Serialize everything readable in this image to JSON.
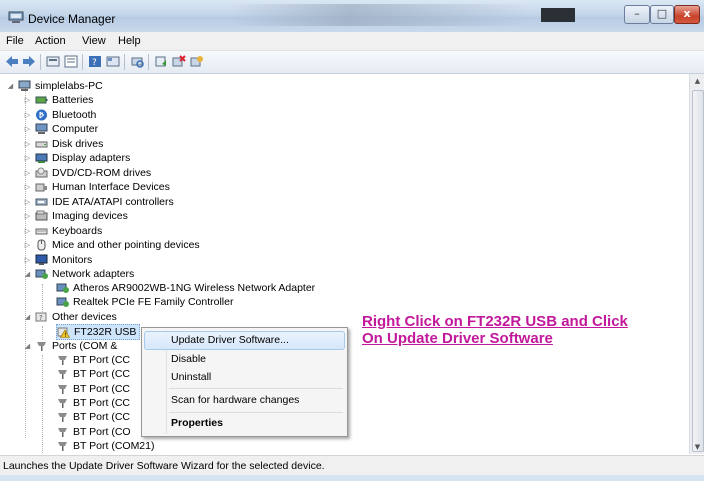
{
  "window": {
    "title": "Device Manager",
    "controls": {
      "minimize": "–",
      "maximize": "□",
      "close": "x"
    }
  },
  "menu": [
    "File",
    "Action",
    "View",
    "Help"
  ],
  "toolbar_icons": [
    "back-arrow-icon",
    "forward-arrow-icon",
    "device-manager-icon",
    "properties-icon",
    "help-icon",
    "view-icon",
    "scan-icon",
    "update-driver-icon",
    "uninstall-icon",
    "disable-icon"
  ],
  "tree": {
    "root": "simplelabs-PC",
    "categories": [
      {
        "label": "Batteries",
        "icon": "battery-icon"
      },
      {
        "label": "Bluetooth",
        "icon": "bluetooth-icon"
      },
      {
        "label": "Computer",
        "icon": "computer-icon"
      },
      {
        "label": "Disk drives",
        "icon": "disk-drive-icon"
      },
      {
        "label": "Display adapters",
        "icon": "display-adapter-icon"
      },
      {
        "label": "DVD/CD-ROM drives",
        "icon": "dvd-drive-icon"
      },
      {
        "label": "Human Interface Devices",
        "icon": "hid-icon"
      },
      {
        "label": "IDE ATA/ATAPI controllers",
        "icon": "ide-controller-icon"
      },
      {
        "label": "Imaging devices",
        "icon": "imaging-device-icon"
      },
      {
        "label": "Keyboards",
        "icon": "keyboard-icon"
      },
      {
        "label": "Mice and other pointing devices",
        "icon": "mouse-icon"
      },
      {
        "label": "Monitors",
        "icon": "monitor-icon"
      }
    ],
    "network": {
      "label": "Network adapters",
      "children": [
        "Atheros AR9002WB-1NG Wireless Network Adapter",
        "Realtek PCIe FE Family Controller"
      ]
    },
    "other": {
      "label": "Other devices",
      "children": [
        "FT232R USB"
      ]
    },
    "ports": {
      "label": "Ports (COM &",
      "children": [
        "BT Port (CC",
        "BT Port (CC",
        "BT Port (CC",
        "BT Port (CC",
        "BT Port (CC",
        "BT Port (CO",
        "BT Port (COM21)"
      ]
    }
  },
  "context_menu": {
    "items": [
      "Update Driver Software...",
      "Disable",
      "Uninstall",
      "Scan for hardware changes",
      "Properties"
    ]
  },
  "annotation": {
    "line1": "Right Click on FT232R USB and Click",
    "line2": "On Update Driver Software"
  },
  "status": "Launches the Update Driver Software Wizard for the selected device.",
  "colors": {
    "annotation": "#c2189b",
    "selection": "#cde4fa"
  }
}
